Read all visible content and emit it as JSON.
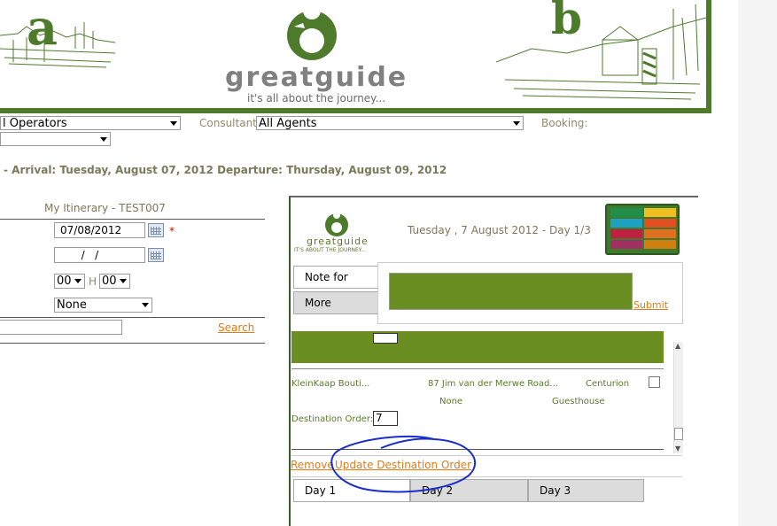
{
  "header": {
    "brand_name": "greatguide",
    "tagline": "it's all about the journey...",
    "left_letter": "a",
    "right_letter": "b"
  },
  "filters": {
    "operators_value": "l Operators",
    "consultant_label": "Consultant:",
    "consultant_value": "All Agents",
    "booking_label": "Booking:"
  },
  "trip_info": "- Arrival: Tuesday, August 07, 2012 Departure: Thursday, August 09, 2012",
  "itinerary": {
    "title": "My Itinerary - TEST007",
    "date_from": "07/08/2012",
    "required_marker": "*",
    "date_to": "  /   /",
    "hour_value": "00",
    "hour_sep": "H",
    "minute_value": "00",
    "type_value": "None",
    "search_link": "Search"
  },
  "day_panel": {
    "logo_text": "greatguide",
    "logo_tagline": "IT'S ABOUT THE JOURNEY...",
    "day_title": "Tuesday , 7 August 2012 - Day 1/3",
    "note_tab": "Note for today",
    "more_tab": "More",
    "submit_link": "Submit",
    "destination_order_label": "Destination Order:",
    "entry": {
      "name": "KleinKaap Bouti...",
      "address": "87 Jim van der Merwe Road...",
      "city": "Centurion",
      "extra": "None",
      "category": "Guesthouse",
      "order_value": "7"
    },
    "remove_link": "Remove",
    "update_link": "Update Destination Order",
    "day_tabs": [
      "Day 1",
      "Day 2",
      "Day 3"
    ]
  },
  "colors": {
    "brand_green": "#4e7a2c",
    "note_green": "#6b8e23",
    "link_orange": "#e07b17",
    "annotation_blue": "#1a2ecc"
  }
}
